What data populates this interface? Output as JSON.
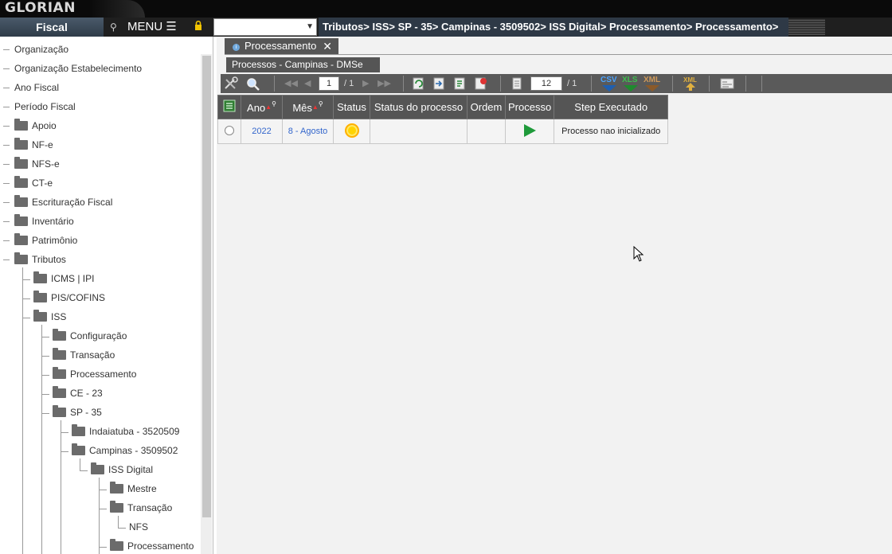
{
  "app": {
    "logo": "GLORIAN",
    "module": "Fiscal",
    "menu_label": "MENU ☰"
  },
  "breadcrumb": "Tributos> ISS> SP - 35> Campinas - 3509502> ISS Digital> Processamento> Processamento>",
  "sidebar": {
    "items": [
      {
        "label": "Organização"
      },
      {
        "label": "Organização Estabelecimento"
      },
      {
        "label": "Ano Fiscal"
      },
      {
        "label": "Período Fiscal"
      },
      {
        "label": "Apoio"
      },
      {
        "label": "NF-e"
      },
      {
        "label": "NFS-e"
      },
      {
        "label": "CT-e"
      },
      {
        "label": "Escrituração Fiscal"
      },
      {
        "label": "Inventário"
      },
      {
        "label": "Patrimônio"
      },
      {
        "label": "Tributos"
      },
      {
        "label": "ICMS | IPI"
      },
      {
        "label": "PIS/COFINS"
      },
      {
        "label": "ISS"
      },
      {
        "label": "Configuração"
      },
      {
        "label": "Transação"
      },
      {
        "label": "Processamento"
      },
      {
        "label": "CE - 23"
      },
      {
        "label": "SP - 35"
      },
      {
        "label": "Indaiatuba - 3520509"
      },
      {
        "label": "Campinas - 3509502"
      },
      {
        "label": "ISS Digital"
      },
      {
        "label": "Mestre"
      },
      {
        "label": "Transação"
      },
      {
        "label": "NFS"
      },
      {
        "label": "Processamento"
      }
    ]
  },
  "tab": {
    "label": "Processamento",
    "close": "✕"
  },
  "panel": {
    "title": "Processos - Campinas - DMSe"
  },
  "toolbar": {
    "page": "1",
    "page_total": "/ 1",
    "page_size": "12",
    "size_total": "/ 1",
    "csv": "CSV",
    "xls": "XLS",
    "xml": "XML",
    "xml2": "XML"
  },
  "grid": {
    "columns": [
      "Ano",
      "Mês",
      "Status",
      "Status do processo",
      "Ordem",
      "Processo",
      "Step Executado"
    ],
    "rows": [
      {
        "ano": "2022",
        "mes": "8 - Agosto",
        "status_do_processo": "",
        "ordem": "",
        "step": "Processo nao inicializado"
      }
    ]
  },
  "colors": {
    "status_pending": "#ffd400",
    "play": "#1f9a3a",
    "link": "#3366cc"
  }
}
